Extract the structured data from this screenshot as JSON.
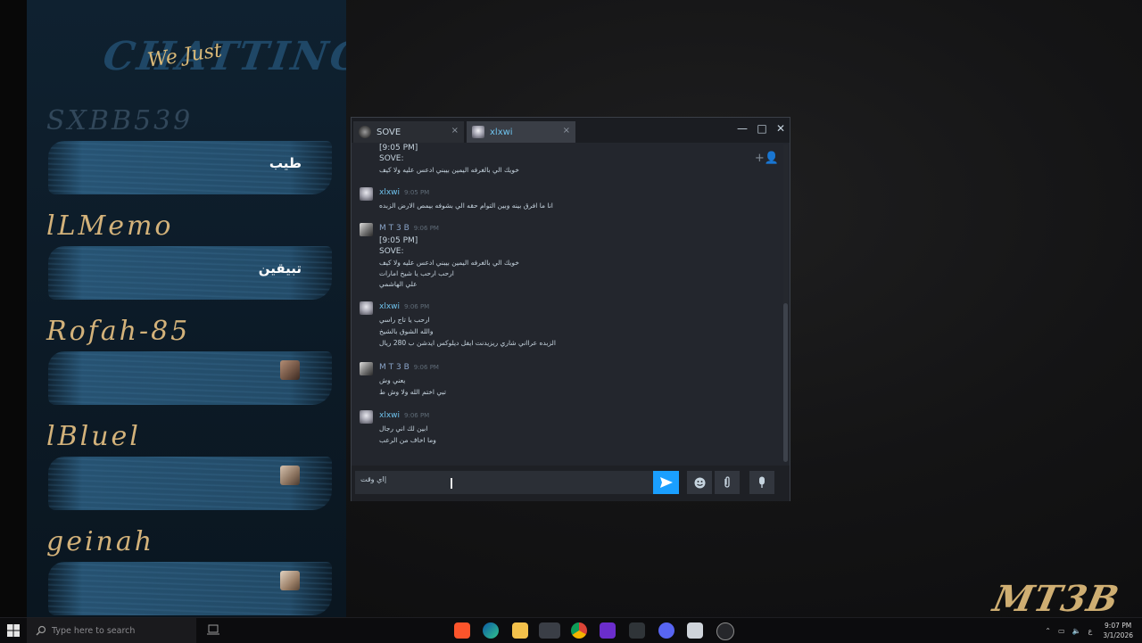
{
  "overlay": {
    "brand_big": "CHATTING",
    "brand_small": "We Just",
    "cards": [
      {
        "name": "SXBB539",
        "message": "طيب"
      },
      {
        "name": "lLMemo",
        "message": "تبيقين"
      },
      {
        "name": "Rofah-85",
        "message": ""
      },
      {
        "name": "lBluel",
        "message": ""
      },
      {
        "name": "geinah",
        "message": ""
      }
    ],
    "corner_logo": "MT3B"
  },
  "chat": {
    "tabs": [
      {
        "label": "SOVE",
        "close": "×"
      },
      {
        "label": "xlxwi",
        "close": "×"
      }
    ],
    "window_controls": {
      "minimize": "—",
      "maximize": "□",
      "close": "✕"
    },
    "messages": [
      {
        "lines": [
          "[9:05 PM]",
          "SOVE:",
          "خويك الي بالغرفه اليمين بيبني ادعس عليه ولا كيف"
        ]
      },
      {
        "author": "xlxwi",
        "time": "9:05 PM",
        "lines": [
          "انا ما افرق بينه وبين التوام حقه الي بشوفه بيمص الارض الزبده"
        ]
      },
      {
        "author": "M T 3 B",
        "time": "9:06 PM",
        "lines": [
          "[9:05 PM]",
          "SOVE:",
          "خويك الي بالغرفه اليمين بيبني ادعس عليه ولا كيف",
          "ارحب ارحب يا شيخ امارات",
          "علي الهاشمي"
        ]
      },
      {
        "author": "xlxwi",
        "time": "9:06 PM",
        "lines": [
          "ارحب يا تاج راسي",
          "والله الشوق بالشيخ",
          "الزبده عرااني شاري ريزيدنت ايفل ديلوكس ايدشن ب 280 ريال"
        ]
      },
      {
        "author": "M T 3 B",
        "time": "9:06 PM",
        "lines": [
          "يعني وش",
          "تبي اختم الله ولا وش ط"
        ]
      },
      {
        "author": "xlxwi",
        "time": "9:06 PM",
        "lines": [
          "ابين لك اني رجال",
          "وما اخاف من الرعب"
        ]
      }
    ],
    "composer_value": "اي وقت|",
    "send_label": "Send"
  },
  "taskbar": {
    "search_placeholder": "Type here to search",
    "time": "9:07 PM",
    "date": "3/1/2026",
    "lang": "ع",
    "apps": [
      "brave-icon",
      "edge-icon",
      "file-explorer-icon",
      "steam-chat-icon",
      "chrome-icon",
      "next-icon",
      "excel-icon",
      "discord-icon",
      "notepad-icon",
      "obs-icon"
    ]
  }
}
